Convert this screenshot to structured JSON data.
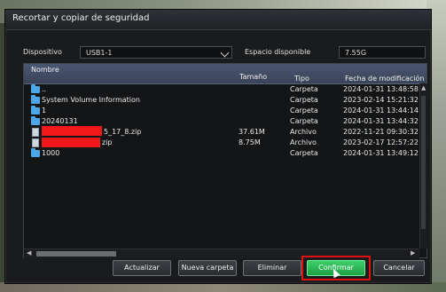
{
  "dialog": {
    "title": "Recortar y copiar de seguridad"
  },
  "device": {
    "label": "Dispositivo",
    "value": "USB1-1"
  },
  "space": {
    "label": "Espacio disponible",
    "value": "7.55G"
  },
  "table": {
    "headers": {
      "name": "Nombre",
      "size": "Tamaño",
      "type": "Tipo",
      "date": "Fecha de modificación"
    },
    "rows": [
      {
        "icon": "folder-icon",
        "name": "..",
        "size": "",
        "type": "Carpeta",
        "date": "2024-01-31 13:48:58"
      },
      {
        "icon": "folder-icon",
        "name": "System Volume Information",
        "size": "",
        "type": "Carpeta",
        "date": "2023-02-14 15:21:32"
      },
      {
        "icon": "folder-icon",
        "name": "1",
        "size": "",
        "type": "Carpeta",
        "date": "2024-01-31 13:44:14"
      },
      {
        "icon": "folder-icon",
        "name": "20240131",
        "size": "",
        "type": "Carpeta",
        "date": "2024-01-31 13:44:32"
      },
      {
        "icon": "file-icon",
        "name": "5_17_8.zip",
        "size": "37.61M",
        "type": "Archivo",
        "date": "2022-11-21 09:30:32"
      },
      {
        "icon": "file-icon",
        "name": "zip",
        "size": "8.75M",
        "type": "Archivo",
        "date": "2023-02-17 12:57:22"
      },
      {
        "icon": "folder-icon",
        "name": "1000",
        "size": "",
        "type": "Carpeta",
        "date": "2024-01-31 13:49:12"
      }
    ]
  },
  "buttons": {
    "refresh": "Actualizar",
    "new_folder": "Nueva carpeta",
    "delete": "Eliminar",
    "confirm": "Confirmar",
    "cancel": "Cancelar"
  },
  "colors": {
    "confirm": "#2bbf58",
    "highlight": "#e01010",
    "header": "#4a5670",
    "folder": "#4aa7e8"
  }
}
